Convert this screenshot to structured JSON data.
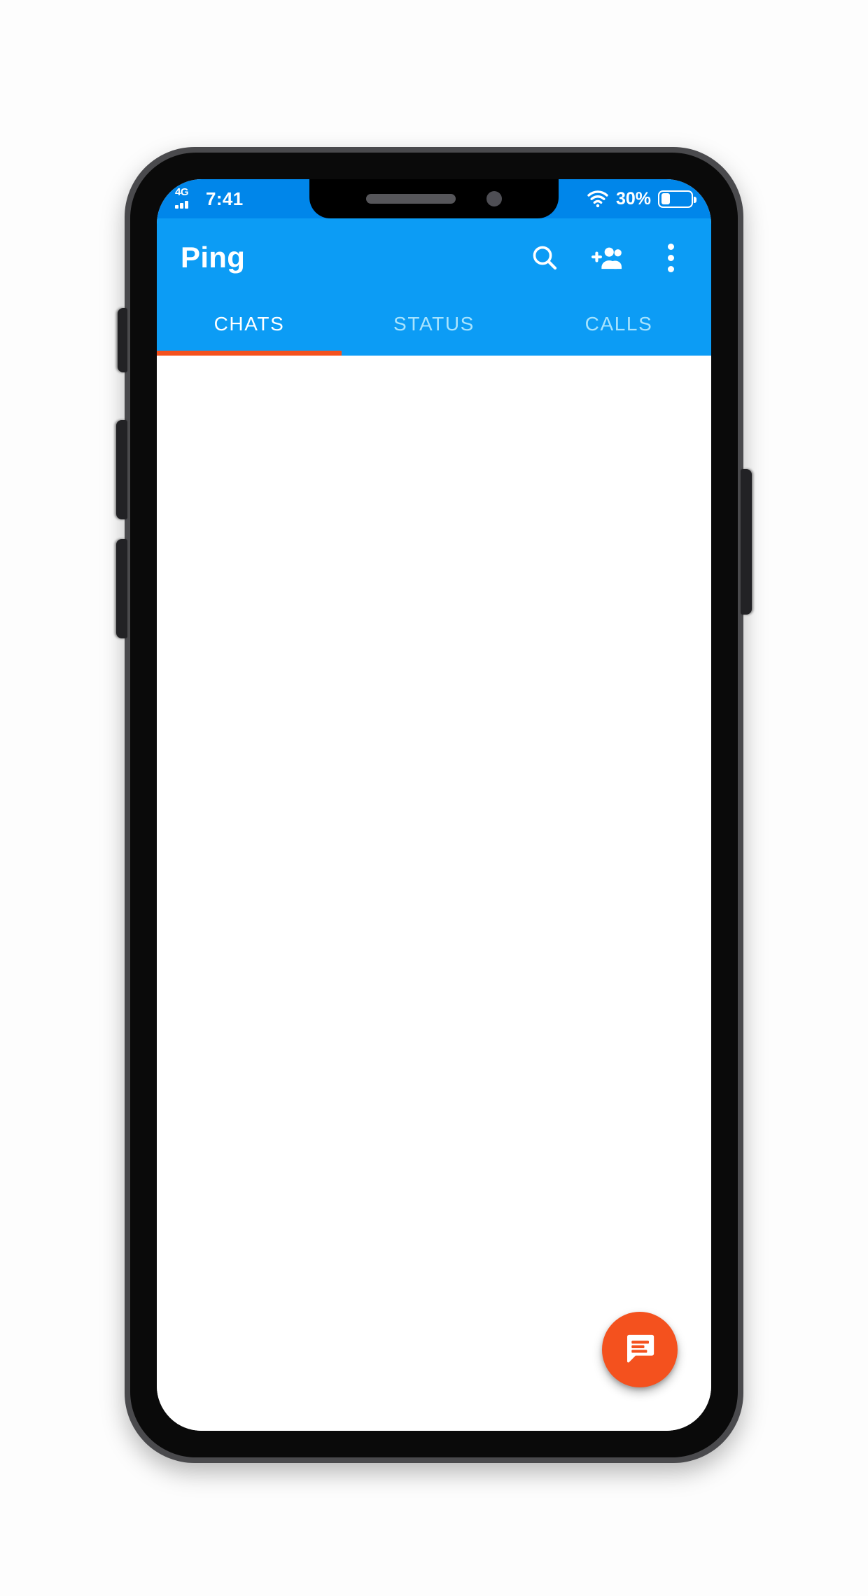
{
  "device": {
    "type": "smartphone",
    "frame_color": "#4a4a4d",
    "bezel_color": "#0a0a0a",
    "buttons": [
      {
        "name": "silent-switch",
        "side": "left"
      },
      {
        "name": "volume-up-button",
        "side": "left"
      },
      {
        "name": "volume-down-button",
        "side": "left"
      },
      {
        "name": "power-button",
        "side": "right"
      }
    ],
    "notch": {
      "earpiece_speaker": "speaker-grille",
      "front_camera": "front-camera-lens"
    }
  },
  "status_bar": {
    "background": "#0086ea",
    "network_label": "4G",
    "signal_icon": "signal-bars-icon",
    "time": "7:41",
    "wifi_icon": "wifi-icon",
    "battery_percent_label": "30%",
    "battery_level": 30,
    "battery_icon": "battery-icon"
  },
  "app_bar": {
    "background": "#0c9cf5",
    "title": "Ping",
    "actions": [
      {
        "name": "search-icon",
        "label": "Search"
      },
      {
        "name": "add-person-icon",
        "label": "Add contact"
      },
      {
        "name": "overflow-menu-icon",
        "label": "More options"
      }
    ]
  },
  "tabs": {
    "active_index": 0,
    "indicator_color": "#f4511e",
    "active_color": "#ffffff",
    "inactive_color": "#a8e3fd",
    "items": [
      {
        "label": "CHATS"
      },
      {
        "label": "STATUS"
      },
      {
        "label": "CALLS"
      }
    ]
  },
  "content": {
    "background": "#ffffff",
    "chat_list_items": [],
    "empty": true
  },
  "fab": {
    "name": "new-chat-fab",
    "icon": "chat-bubble-icon",
    "background": "#f4511e",
    "icon_color": "#ffffff"
  }
}
